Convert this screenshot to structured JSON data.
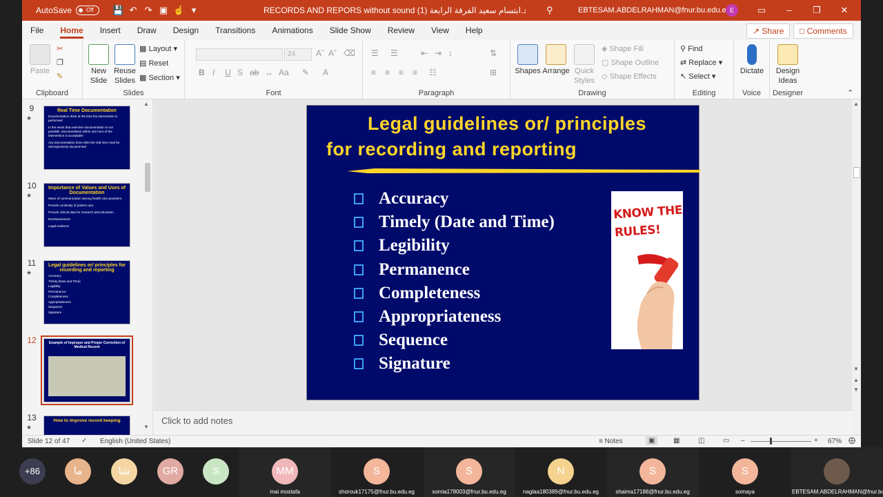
{
  "titlebar": {
    "autosave": "AutoSave",
    "autosave_state": "Off",
    "title": "RECORDS AND REPORS without sound (1) د.ابتسام سعيد الفرقة الرابعة",
    "user": "EBTESAM.ABDELRAHMAN@fnur.bu.edu.eg",
    "user_initial": "E"
  },
  "menu": {
    "tabs": [
      "File",
      "Home",
      "Insert",
      "Draw",
      "Design",
      "Transitions",
      "Animations",
      "Slide Show",
      "Review",
      "View",
      "Help"
    ],
    "active": "Home",
    "share": "Share",
    "comments": "Comments"
  },
  "ribbon": {
    "clipboard": {
      "label": "Clipboard",
      "paste": "Paste"
    },
    "slides": {
      "label": "Slides",
      "new_slide": "New Slide",
      "reuse": "Reuse Slides",
      "layout": "Layout",
      "reset": "Reset",
      "section": "Section"
    },
    "font": {
      "label": "Font",
      "size": "24"
    },
    "paragraph": {
      "label": "Paragraph"
    },
    "drawing": {
      "label": "Drawing",
      "shapes": "Shapes",
      "arrange": "Arrange",
      "quick_styles": "Quick Styles",
      "shape_fill": "Shape Fill",
      "shape_outline": "Shape Outline",
      "shape_effects": "Shape Effects"
    },
    "editing": {
      "label": "Editing",
      "find": "Find",
      "replace": "Replace",
      "select": "Select"
    },
    "voice": {
      "label": "Voice",
      "dictate": "Dictate"
    },
    "designer": {
      "label": "Designer",
      "design_ideas": "Design Ideas"
    }
  },
  "thumbnails": [
    {
      "num": "9",
      "title": "Real Time Documentation",
      "lines": [
        "Documentation done at the time the intervention is performed",
        "In the event that real-time documentation is not possible, documentation within one hour of the intervention is acceptable",
        "Any documentation done after the real time must be retrospectively documented"
      ]
    },
    {
      "num": "10",
      "title": "Importance of Values and Uses of Documentation",
      "lines": [
        "Mean of communication among health care providers.",
        "Provide continuity of patient care.",
        "Provide clinical data for research and education.",
        "Reimbursement",
        "Legal evidence"
      ]
    },
    {
      "num": "11",
      "title": "Legal guidelines or/ principles for recording and reporting",
      "lines": [
        "Accuracy",
        "Timely (Date and Time)",
        "Legibility",
        "Permanence",
        "Completeness",
        "Appropriateness",
        "Sequence",
        "Signature"
      ]
    },
    {
      "num": "12",
      "title": "Example of Improper and Proper Correction of Medical Record",
      "lines": []
    },
    {
      "num": "13",
      "title": "How to improve record keeping",
      "lines": []
    }
  ],
  "slide": {
    "title_line1": "Legal guidelines or/ principles",
    "title_line2": "for recording and reporting",
    "bullets": [
      "Accuracy",
      "Timely (Date and Time)",
      "Legibility",
      "Permanence",
      "Completeness",
      "Appropriateness",
      "Sequence",
      "Signature"
    ],
    "image_text": "KNOW THE RULES!"
  },
  "notes": {
    "placeholder": "Click to add notes"
  },
  "status": {
    "slide": "Slide 12 of 47",
    "language": "English (United States)",
    "notes": "Notes",
    "zoom": "67%"
  },
  "participants": [
    {
      "label": "+86",
      "color": "#3d3d52",
      "name": ""
    },
    {
      "label": "ما",
      "color": "#e8b48c",
      "name": ""
    },
    {
      "label": "شا",
      "color": "#f5d6a3",
      "name": ""
    },
    {
      "label": "GR",
      "color": "#e0a9a2",
      "name": ""
    },
    {
      "label": "S",
      "color": "#c9e6c4",
      "name": ""
    },
    {
      "label": "MM",
      "color": "#f0b8ba",
      "name": "mai mostafa"
    },
    {
      "label": "S",
      "color": "#f3b69b",
      "name": "shorouk17175@fnur.bu.edu.eg"
    },
    {
      "label": "S",
      "color": "#f3b69b",
      "name": "somia178003@fnur.bu.edu.eg"
    },
    {
      "label": "N",
      "color": "#f5d28e",
      "name": "naglaa180389@fnur.bu.edu.eg"
    },
    {
      "label": "S",
      "color": "#f3b69b",
      "name": "shaima17188@fnur.bu.edu.eg"
    },
    {
      "label": "S",
      "color": "#f3b69b",
      "name": "somaya"
    },
    {
      "label": "",
      "color": "#6d5a4c",
      "name": "EBTESAM.ABDELRAHMAN@fnur.bu..."
    }
  ],
  "colors": {
    "accent": "#c43e1c",
    "slide_bg": "#000a6b",
    "title": "#ffd528"
  }
}
